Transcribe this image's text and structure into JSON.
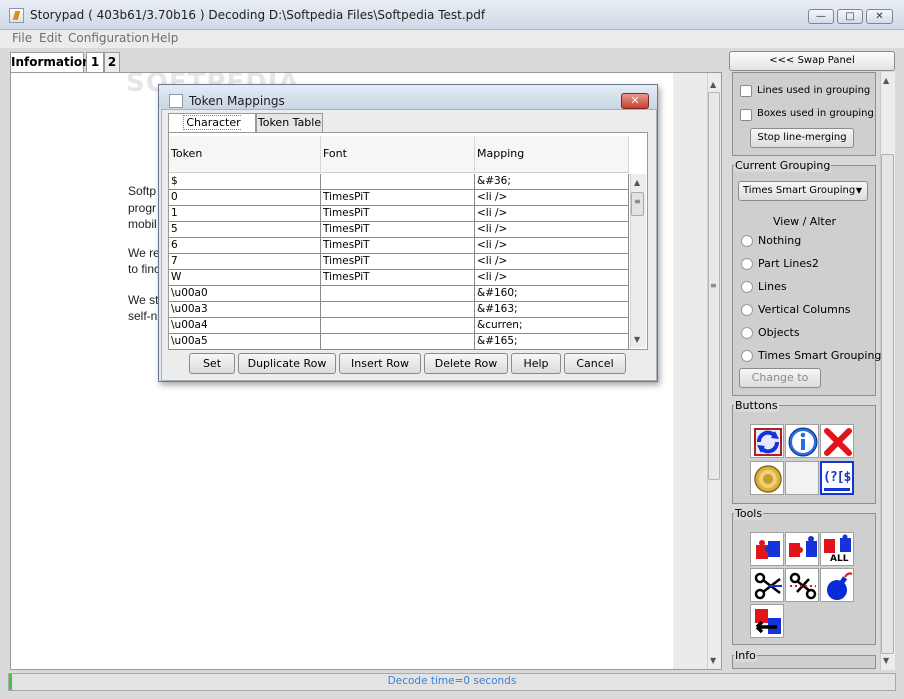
{
  "window": {
    "title": "Storypad ( 403b61/3.70b16 )  Decoding D:\\Softpedia Files\\Softpedia Test.pdf",
    "min": "—",
    "max": "□",
    "close": "✕"
  },
  "menu": [
    "File",
    "Edit",
    "Configuration",
    "Help"
  ],
  "tabs": [
    "Information",
    "1",
    "2"
  ],
  "watermark": "SOFTPEDIA",
  "document": {
    "lines": [
      "Softp",
      "progr",
      "mobil",
      "We re",
      "to finc",
      "We st",
      "self-n"
    ]
  },
  "dialog": {
    "title": "Token Mappings",
    "close": "✕",
    "tabs": [
      "Character Table",
      "Token Table"
    ],
    "columns": [
      "Token",
      "Font",
      "Mapping"
    ],
    "rows": [
      [
        "$",
        "",
        "&#36;"
      ],
      [
        "0",
        "TimesPiT",
        "<li />"
      ],
      [
        "1",
        "TimesPiT",
        "<li />"
      ],
      [
        "5",
        "TimesPiT",
        "<li />"
      ],
      [
        "6",
        "TimesPiT",
        "<li />"
      ],
      [
        "7",
        "TimesPiT",
        "<li />"
      ],
      [
        "W",
        "TimesPiT",
        "<li />"
      ],
      [
        "\\u00a0",
        "",
        "&#160;"
      ],
      [
        "\\u00a3",
        "",
        "&#163;"
      ],
      [
        "\\u00a4",
        "",
        "&curren;"
      ],
      [
        "\\u00a5",
        "",
        "&#165;"
      ]
    ],
    "buttons": [
      "Set",
      "Duplicate Row",
      "Insert Row",
      "Delete Row",
      "Help",
      "Cancel"
    ]
  },
  "right_panel": {
    "swap": "<<< Swap Panel",
    "lines_used": "Lines used in grouping",
    "boxes_used": "Boxes used in grouping",
    "stop_merging": "Stop line-merging",
    "current_grouping": "Current Grouping",
    "grouping_value": "Times Smart Grouping",
    "view_alter": "View / Alter",
    "radios": [
      "Nothing",
      "Part Lines2",
      "Lines",
      "Vertical Columns",
      "Objects",
      "Times Smart Grouping"
    ],
    "change_to": "Change  to",
    "buttons_title": "Buttons",
    "tools_title": "Tools",
    "info_title": "Info",
    "button_text": "(?[$",
    "tool_all": "ALL"
  },
  "status": "Decode time=0 seconds",
  "colors": {
    "accent_blue": "#3d7fd5",
    "puzzle_red": "#e1131b",
    "puzzle_blue": "#1433d8",
    "close_red": "#c8402c"
  }
}
